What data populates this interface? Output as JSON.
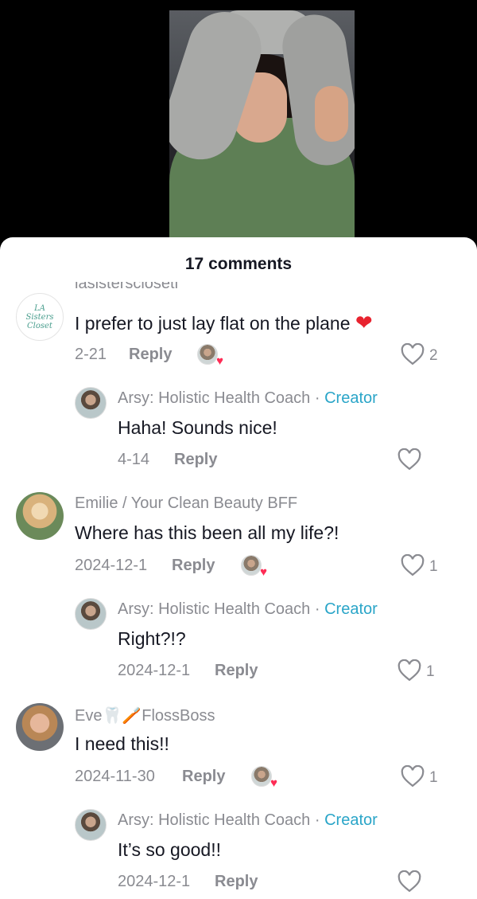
{
  "sheet": {
    "title": "17 comments"
  },
  "comments": [
    {
      "username": "lasistersclosetl",
      "avatar_text": "LA Sisters Closet",
      "text": "I prefer to just lay flat on the plane",
      "emoji": "❤",
      "date": "2-21",
      "reply": "Reply",
      "likes": "2"
    },
    {
      "username": "Arsy: Holistic Health Coach",
      "badge": "Creator",
      "text": "Haha! Sounds nice!",
      "date": "4-14",
      "reply": "Reply",
      "likes": ""
    },
    {
      "username": "Emilie / Your Clean Beauty BFF",
      "text": "Where has this been all my life?!",
      "date": "2024-12-1",
      "reply": "Reply",
      "likes": "1"
    },
    {
      "username": "Arsy: Holistic Health Coach",
      "badge": "Creator",
      "text": "Right?!?",
      "date": "2024-12-1",
      "reply": "Reply",
      "likes": "1"
    },
    {
      "username": "Eve🦷🪥FlossBoss",
      "text": "I need this!!",
      "date": "2024-11-30",
      "reply": "Reply",
      "likes": "1"
    },
    {
      "username": "Arsy: Holistic Health Coach",
      "badge": "Creator",
      "text": "It’s so good!!",
      "date": "2024-12-1",
      "reply": "Reply",
      "likes": ""
    }
  ],
  "separator": "·",
  "colors": {
    "creator": "#2aa5c8",
    "muted": "#8a8b91",
    "text": "#161823",
    "like_heart": "#fe2c55"
  }
}
